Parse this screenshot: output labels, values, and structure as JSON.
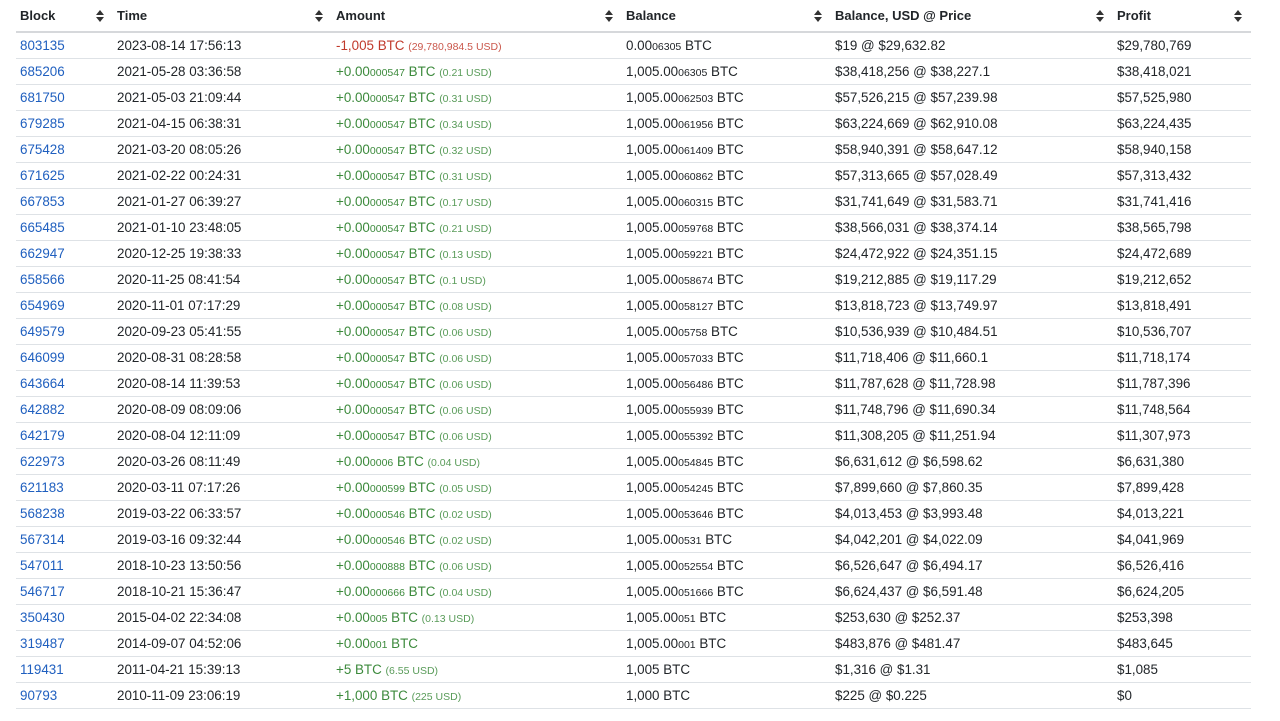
{
  "columns": [
    "Block",
    "Time",
    "Amount",
    "Balance",
    "Balance, USD @ Price",
    "Profit"
  ],
  "rows": [
    {
      "block": "803135",
      "time": "2023-08-14 17:56:13",
      "amount_main": "-1,005",
      "amount_small": "",
      "amount_unit": " BTC",
      "amount_usd": "(29,780,984.5 USD)",
      "sign": "neg",
      "bal_main": "0.00",
      "bal_small": "06305",
      "bal_unit": " BTC",
      "bal_usd": "$19 @ $29,632.82",
      "profit": "$29,780,769"
    },
    {
      "block": "685206",
      "time": "2021-05-28 03:36:58",
      "amount_main": "+0.00",
      "amount_small": "000547",
      "amount_unit": " BTC",
      "amount_usd": "(0.21 USD)",
      "sign": "pos",
      "bal_main": "1,005.00",
      "bal_small": "06305",
      "bal_unit": " BTC",
      "bal_usd": "$38,418,256 @ $38,227.1",
      "profit": "$38,418,021"
    },
    {
      "block": "681750",
      "time": "2021-05-03 21:09:44",
      "amount_main": "+0.00",
      "amount_small": "000547",
      "amount_unit": " BTC",
      "amount_usd": "(0.31 USD)",
      "sign": "pos",
      "bal_main": "1,005.00",
      "bal_small": "062503",
      "bal_unit": " BTC",
      "bal_usd": "$57,526,215 @ $57,239.98",
      "profit": "$57,525,980"
    },
    {
      "block": "679285",
      "time": "2021-04-15 06:38:31",
      "amount_main": "+0.00",
      "amount_small": "000547",
      "amount_unit": " BTC",
      "amount_usd": "(0.34 USD)",
      "sign": "pos",
      "bal_main": "1,005.00",
      "bal_small": "061956",
      "bal_unit": " BTC",
      "bal_usd": "$63,224,669 @ $62,910.08",
      "profit": "$63,224,435"
    },
    {
      "block": "675428",
      "time": "2021-03-20 08:05:26",
      "amount_main": "+0.00",
      "amount_small": "000547",
      "amount_unit": " BTC",
      "amount_usd": "(0.32 USD)",
      "sign": "pos",
      "bal_main": "1,005.00",
      "bal_small": "061409",
      "bal_unit": " BTC",
      "bal_usd": "$58,940,391 @ $58,647.12",
      "profit": "$58,940,158"
    },
    {
      "block": "671625",
      "time": "2021-02-22 00:24:31",
      "amount_main": "+0.00",
      "amount_small": "000547",
      "amount_unit": " BTC",
      "amount_usd": "(0.31 USD)",
      "sign": "pos",
      "bal_main": "1,005.00",
      "bal_small": "060862",
      "bal_unit": " BTC",
      "bal_usd": "$57,313,665 @ $57,028.49",
      "profit": "$57,313,432"
    },
    {
      "block": "667853",
      "time": "2021-01-27 06:39:27",
      "amount_main": "+0.00",
      "amount_small": "000547",
      "amount_unit": " BTC",
      "amount_usd": "(0.17 USD)",
      "sign": "pos",
      "bal_main": "1,005.00",
      "bal_small": "060315",
      "bal_unit": " BTC",
      "bal_usd": "$31,741,649 @ $31,583.71",
      "profit": "$31,741,416"
    },
    {
      "block": "665485",
      "time": "2021-01-10 23:48:05",
      "amount_main": "+0.00",
      "amount_small": "000547",
      "amount_unit": " BTC",
      "amount_usd": "(0.21 USD)",
      "sign": "pos",
      "bal_main": "1,005.00",
      "bal_small": "059768",
      "bal_unit": " BTC",
      "bal_usd": "$38,566,031 @ $38,374.14",
      "profit": "$38,565,798"
    },
    {
      "block": "662947",
      "time": "2020-12-25 19:38:33",
      "amount_main": "+0.00",
      "amount_small": "000547",
      "amount_unit": " BTC",
      "amount_usd": "(0.13 USD)",
      "sign": "pos",
      "bal_main": "1,005.00",
      "bal_small": "059221",
      "bal_unit": " BTC",
      "bal_usd": "$24,472,922 @ $24,351.15",
      "profit": "$24,472,689"
    },
    {
      "block": "658566",
      "time": "2020-11-25 08:41:54",
      "amount_main": "+0.00",
      "amount_small": "000547",
      "amount_unit": " BTC",
      "amount_usd": "(0.1 USD)",
      "sign": "pos",
      "bal_main": "1,005.00",
      "bal_small": "058674",
      "bal_unit": " BTC",
      "bal_usd": "$19,212,885 @ $19,117.29",
      "profit": "$19,212,652"
    },
    {
      "block": "654969",
      "time": "2020-11-01 07:17:29",
      "amount_main": "+0.00",
      "amount_small": "000547",
      "amount_unit": " BTC",
      "amount_usd": "(0.08 USD)",
      "sign": "pos",
      "bal_main": "1,005.00",
      "bal_small": "058127",
      "bal_unit": " BTC",
      "bal_usd": "$13,818,723 @ $13,749.97",
      "profit": "$13,818,491"
    },
    {
      "block": "649579",
      "time": "2020-09-23 05:41:55",
      "amount_main": "+0.00",
      "amount_small": "000547",
      "amount_unit": " BTC",
      "amount_usd": "(0.06 USD)",
      "sign": "pos",
      "bal_main": "1,005.00",
      "bal_small": "05758",
      "bal_unit": " BTC",
      "bal_usd": "$10,536,939 @ $10,484.51",
      "profit": "$10,536,707"
    },
    {
      "block": "646099",
      "time": "2020-08-31 08:28:58",
      "amount_main": "+0.00",
      "amount_small": "000547",
      "amount_unit": " BTC",
      "amount_usd": "(0.06 USD)",
      "sign": "pos",
      "bal_main": "1,005.00",
      "bal_small": "057033",
      "bal_unit": " BTC",
      "bal_usd": "$11,718,406 @ $11,660.1",
      "profit": "$11,718,174"
    },
    {
      "block": "643664",
      "time": "2020-08-14 11:39:53",
      "amount_main": "+0.00",
      "amount_small": "000547",
      "amount_unit": " BTC",
      "amount_usd": "(0.06 USD)",
      "sign": "pos",
      "bal_main": "1,005.00",
      "bal_small": "056486",
      "bal_unit": " BTC",
      "bal_usd": "$11,787,628 @ $11,728.98",
      "profit": "$11,787,396"
    },
    {
      "block": "642882",
      "time": "2020-08-09 08:09:06",
      "amount_main": "+0.00",
      "amount_small": "000547",
      "amount_unit": " BTC",
      "amount_usd": "(0.06 USD)",
      "sign": "pos",
      "bal_main": "1,005.00",
      "bal_small": "055939",
      "bal_unit": " BTC",
      "bal_usd": "$11,748,796 @ $11,690.34",
      "profit": "$11,748,564"
    },
    {
      "block": "642179",
      "time": "2020-08-04 12:11:09",
      "amount_main": "+0.00",
      "amount_small": "000547",
      "amount_unit": " BTC",
      "amount_usd": "(0.06 USD)",
      "sign": "pos",
      "bal_main": "1,005.00",
      "bal_small": "055392",
      "bal_unit": " BTC",
      "bal_usd": "$11,308,205 @ $11,251.94",
      "profit": "$11,307,973"
    },
    {
      "block": "622973",
      "time": "2020-03-26 08:11:49",
      "amount_main": "+0.00",
      "amount_small": "0006",
      "amount_unit": " BTC",
      "amount_usd": "(0.04 USD)",
      "sign": "pos",
      "bal_main": "1,005.00",
      "bal_small": "054845",
      "bal_unit": " BTC",
      "bal_usd": "$6,631,612 @ $6,598.62",
      "profit": "$6,631,380"
    },
    {
      "block": "621183",
      "time": "2020-03-11 07:17:26",
      "amount_main": "+0.00",
      "amount_small": "000599",
      "amount_unit": " BTC",
      "amount_usd": "(0.05 USD)",
      "sign": "pos",
      "bal_main": "1,005.00",
      "bal_small": "054245",
      "bal_unit": " BTC",
      "bal_usd": "$7,899,660 @ $7,860.35",
      "profit": "$7,899,428"
    },
    {
      "block": "568238",
      "time": "2019-03-22 06:33:57",
      "amount_main": "+0.00",
      "amount_small": "000546",
      "amount_unit": " BTC",
      "amount_usd": "(0.02 USD)",
      "sign": "pos",
      "bal_main": "1,005.00",
      "bal_small": "053646",
      "bal_unit": " BTC",
      "bal_usd": "$4,013,453 @ $3,993.48",
      "profit": "$4,013,221"
    },
    {
      "block": "567314",
      "time": "2019-03-16 09:32:44",
      "amount_main": "+0.00",
      "amount_small": "000546",
      "amount_unit": " BTC",
      "amount_usd": "(0.02 USD)",
      "sign": "pos",
      "bal_main": "1,005.00",
      "bal_small": "0531",
      "bal_unit": " BTC",
      "bal_usd": "$4,042,201 @ $4,022.09",
      "profit": "$4,041,969"
    },
    {
      "block": "547011",
      "time": "2018-10-23 13:50:56",
      "amount_main": "+0.00",
      "amount_small": "000888",
      "amount_unit": " BTC",
      "amount_usd": "(0.06 USD)",
      "sign": "pos",
      "bal_main": "1,005.00",
      "bal_small": "052554",
      "bal_unit": " BTC",
      "bal_usd": "$6,526,647 @ $6,494.17",
      "profit": "$6,526,416"
    },
    {
      "block": "546717",
      "time": "2018-10-21 15:36:47",
      "amount_main": "+0.00",
      "amount_small": "000666",
      "amount_unit": " BTC",
      "amount_usd": "(0.04 USD)",
      "sign": "pos",
      "bal_main": "1,005.00",
      "bal_small": "051666",
      "bal_unit": " BTC",
      "bal_usd": "$6,624,437 @ $6,591.48",
      "profit": "$6,624,205"
    },
    {
      "block": "350430",
      "time": "2015-04-02 22:34:08",
      "amount_main": "+0.00",
      "amount_small": "005",
      "amount_unit": " BTC",
      "amount_usd": "(0.13 USD)",
      "sign": "pos",
      "bal_main": "1,005.00",
      "bal_small": "051",
      "bal_unit": " BTC",
      "bal_usd": "$253,630 @ $252.37",
      "profit": "$253,398"
    },
    {
      "block": "319487",
      "time": "2014-09-07 04:52:06",
      "amount_main": "+0.00",
      "amount_small": "001",
      "amount_unit": " BTC",
      "amount_usd": "",
      "sign": "pos",
      "bal_main": "1,005.00",
      "bal_small": "001",
      "bal_unit": " BTC",
      "bal_usd": "$483,876 @ $481.47",
      "profit": "$483,645"
    },
    {
      "block": "119431",
      "time": "2011-04-21 15:39:13",
      "amount_main": "+5",
      "amount_small": "",
      "amount_unit": " BTC",
      "amount_usd": "(6.55 USD)",
      "sign": "pos",
      "bal_main": "1,005",
      "bal_small": "",
      "bal_unit": " BTC",
      "bal_usd": "$1,316 @ $1.31",
      "profit": "$1,085"
    },
    {
      "block": "90793",
      "time": "2010-11-09 23:06:19",
      "amount_main": "+1,000",
      "amount_small": "",
      "amount_unit": " BTC",
      "amount_usd": "(225 USD)",
      "sign": "pos",
      "bal_main": "1,000",
      "bal_small": "",
      "bal_unit": " BTC",
      "bal_usd": "$225 @ $0.225",
      "profit": "$0"
    }
  ],
  "colors": {
    "link": "#1f5fbf",
    "positive": "#3c8a3c",
    "negative": "#c0392b"
  },
  "icons": {
    "sort": "sort-updown-icon"
  }
}
